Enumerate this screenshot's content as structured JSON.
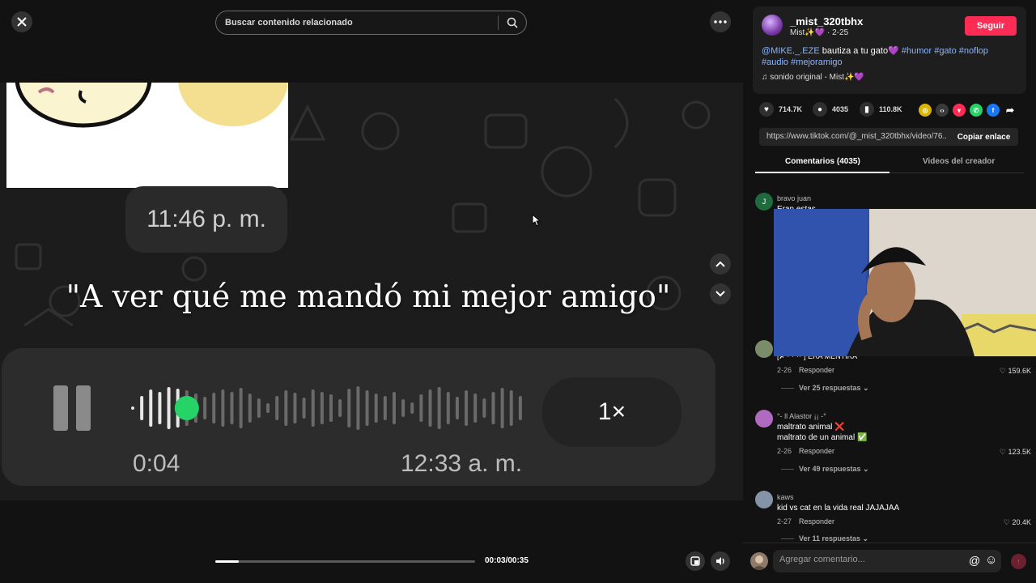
{
  "search": {
    "placeholder": "Buscar contenido relacionado"
  },
  "video": {
    "caption": "\"A ver qué me mandó mi mejor amigo\"",
    "bubble_time": "11:46 p. m.",
    "voice_elapsed": "0:04",
    "voice_timestamp": "12:33 a. m.",
    "voice_speed": "1×",
    "voice_progress": 0.14,
    "progress": 0.09,
    "time_readout": "00:03/00:35"
  },
  "author": {
    "name": "_mist_320tbhx",
    "meta": "Mist✨💜 · 2-25",
    "follow_label": "Seguir",
    "desc_mention": "@MIKE._.EZE",
    "desc_text": " bautiza a tu gato💜 ",
    "desc_tags": "#humor #gato #noflop #audio #mejoramigo",
    "sound": "♫  sonido original - Mist✨💜"
  },
  "actions": {
    "likes": "714.7K",
    "comments": "4035",
    "saves": "110.8K"
  },
  "link": {
    "url": "https://www.tiktok.com/@_mist_320tbhx/video/76...",
    "copy_label": "Copiar enlace"
  },
  "tabs": {
    "comments": "Comentarios (4035)",
    "creator": "Videos del creador"
  },
  "comments": [
    {
      "user": "bravo juan",
      "text": "Eran estas"
    },
    {
      "user": "",
      "text": "[✗ ⁷ ⁷ ⁷⁷ ] ERA MENTIRA",
      "date": "2-26",
      "reply": "Responder",
      "likes": "159.6K",
      "more": "Ver 25 respuestas ⌄"
    },
    {
      "user": "°- ll Alastor ¡¡ -°",
      "text": "maltrato animal ❌",
      "text2": "maltrato de un animal ✅",
      "date": "2-26",
      "reply": "Responder",
      "likes": "123.5K",
      "more": "Ver 49 respuestas ⌄"
    },
    {
      "user": "kaws",
      "text": "kid vs cat en la vida real JAJAJAA",
      "date": "2-27",
      "reply": "Responder",
      "likes": "20.4K",
      "more": "Ver 11 respuestas ⌄"
    }
  ],
  "comment_bar": {
    "placeholder": "Agregar comentario..."
  },
  "colors": {
    "accent": "#fe2c55",
    "link": "#8ab4ff",
    "voice_dot": "#25d366"
  }
}
